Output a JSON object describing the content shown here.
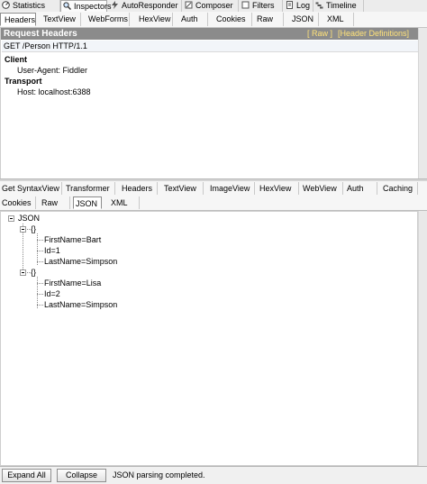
{
  "top_tabs": [
    {
      "label": "Statistics",
      "icon": "statistics-icon"
    },
    {
      "label": "Inspectors",
      "icon": "inspectors-icon"
    },
    {
      "label": "AutoResponder",
      "icon": "autoresponder-icon"
    },
    {
      "label": "Composer",
      "icon": "composer-icon"
    },
    {
      "label": "Filters",
      "icon": "filters-icon"
    },
    {
      "label": "Log",
      "icon": "log-icon"
    },
    {
      "label": "Timeline",
      "icon": "timeline-icon"
    }
  ],
  "request_tabs": [
    "Headers",
    "TextView",
    "WebForms",
    "HexView",
    "Auth",
    "Cookies",
    "Raw",
    "JSON",
    "XML"
  ],
  "request_headers": {
    "title": "Request Headers",
    "raw_link": "[ Raw ]",
    "definitions_link": "[Header Definitions]",
    "request_line": "GET /Person HTTP/1.1",
    "groups": [
      {
        "name": "Client",
        "headers": [
          "User-Agent: Fiddler"
        ]
      },
      {
        "name": "Transport",
        "headers": [
          "Host: localhost:6388"
        ]
      }
    ]
  },
  "response_tabs_row1": [
    "Get SyntaxView",
    "Transformer",
    "Headers",
    "TextView",
    "ImageView",
    "HexView",
    "WebView",
    "Auth",
    "Caching"
  ],
  "response_tabs_row2": [
    "Cookies",
    "Raw",
    "JSON",
    "XML"
  ],
  "tree": {
    "root": "JSON",
    "objects": [
      {
        "label": "{}",
        "fields": [
          "FirstName=Bart",
          "Id=1",
          "LastName=Simpson"
        ]
      },
      {
        "label": "{}",
        "fields": [
          "FirstName=Lisa",
          "Id=2",
          "LastName=Simpson"
        ]
      }
    ]
  },
  "bottom": {
    "expand_all": "Expand All",
    "collapse": "Collapse",
    "status": "JSON parsing completed."
  },
  "colors": {
    "header_bar": "#8b8b8b",
    "link_yellow": "#ffe27a"
  }
}
